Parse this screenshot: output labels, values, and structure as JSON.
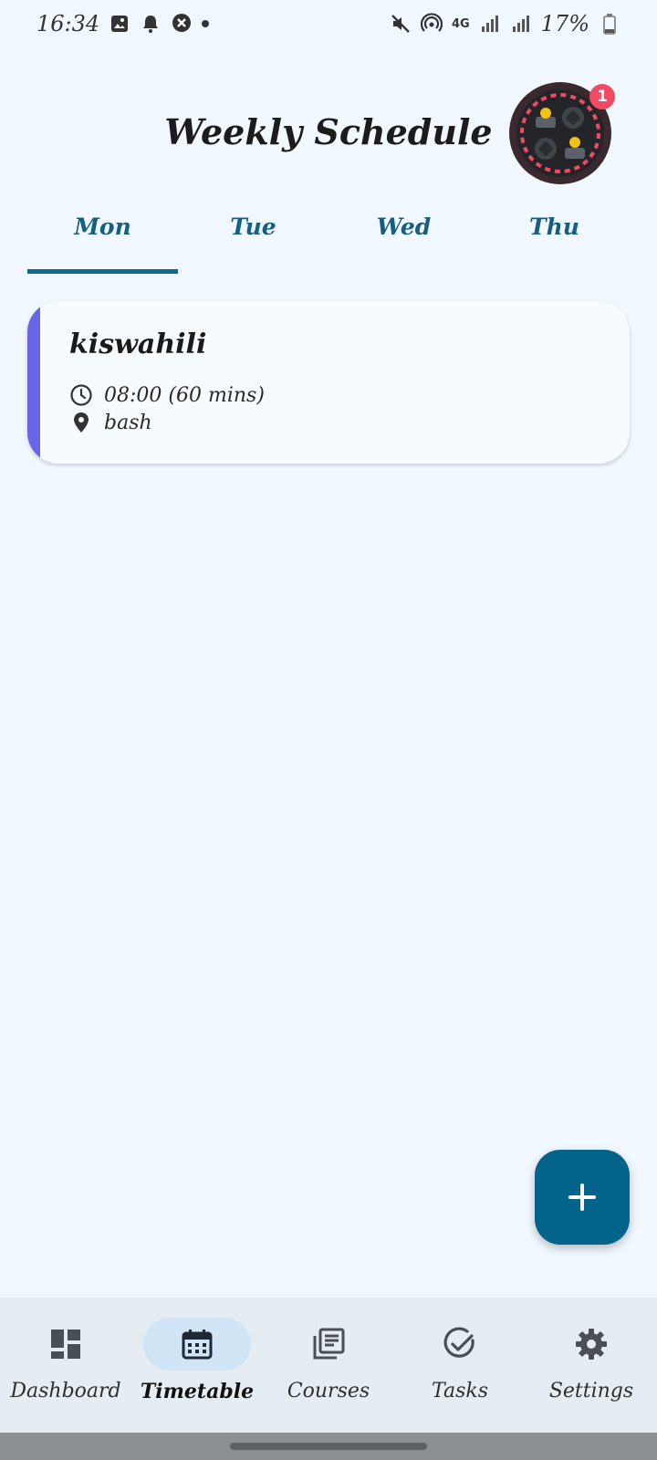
{
  "status_bar": {
    "time": "16:34",
    "battery": "17%",
    "network": "4G"
  },
  "header": {
    "title": "Weekly Schedule",
    "notification_count": "1"
  },
  "tabs": [
    {
      "label": "Mon",
      "active": true
    },
    {
      "label": "Tue",
      "active": false
    },
    {
      "label": "Wed",
      "active": false
    },
    {
      "label": "Thu",
      "active": false
    }
  ],
  "classes": [
    {
      "title": "kiswahili",
      "time": "08:00 (60 mins)",
      "location": "bash",
      "accent_color": "#6a66ec"
    }
  ],
  "fab": {
    "icon": "plus-icon"
  },
  "bottom_nav": [
    {
      "label": "Dashboard",
      "icon": "dashboard-icon",
      "active": false
    },
    {
      "label": "Timetable",
      "icon": "calendar-icon",
      "active": true
    },
    {
      "label": "Courses",
      "icon": "library-icon",
      "active": false
    },
    {
      "label": "Tasks",
      "icon": "check-circle-icon",
      "active": false
    },
    {
      "label": "Settings",
      "icon": "gear-icon",
      "active": false
    }
  ],
  "colors": {
    "background": "#f1f8ff",
    "primary": "#04638a",
    "tab_text": "#165f80",
    "badge": "#ef4b63",
    "nav_background": "#e5edf3",
    "nav_active_pill": "#cfe5f5"
  }
}
